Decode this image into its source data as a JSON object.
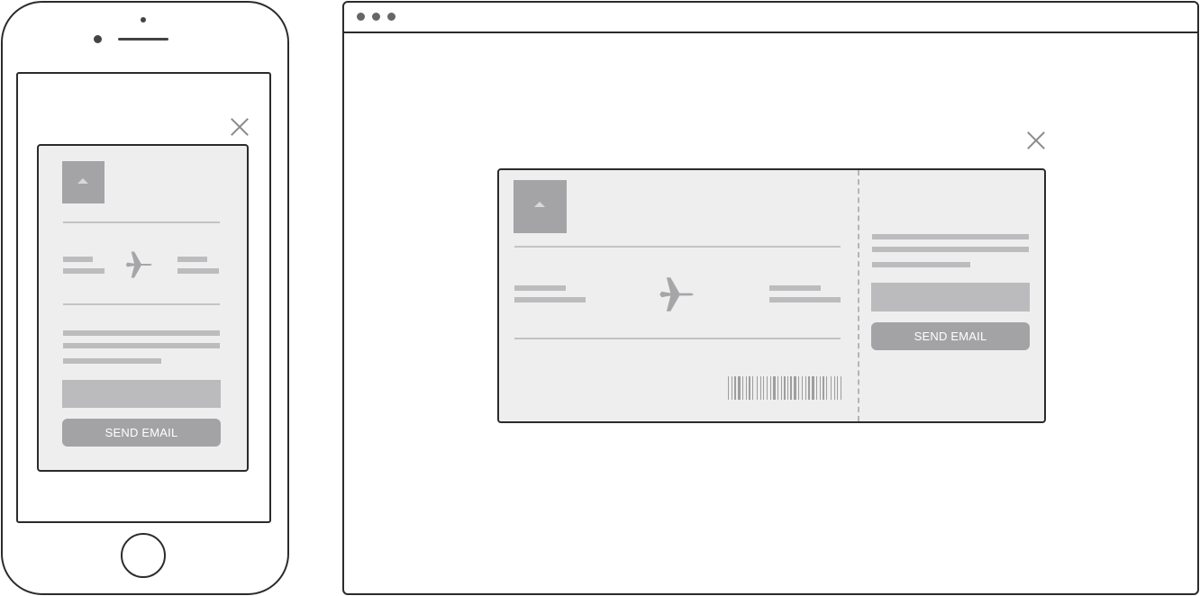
{
  "mobile": {
    "modal": {
      "close_icon": "close-icon",
      "image_icon": "image-placeholder-icon",
      "flight_icon": "airplane-icon",
      "button_label": "SEND EMAIL"
    }
  },
  "desktop": {
    "window_controls": [
      "dot",
      "dot",
      "dot"
    ],
    "modal": {
      "close_icon": "close-icon",
      "image_icon": "image-placeholder-icon",
      "flight_icon": "airplane-icon",
      "barcode_icon": "barcode-icon",
      "button_label": "SEND EMAIL"
    }
  },
  "colors": {
    "outline": "#2b2b2b",
    "card_bg": "#eeeeee",
    "placeholder": "#bcbcbe",
    "button": "#a3a3a5",
    "button_text": "#ffffff"
  }
}
